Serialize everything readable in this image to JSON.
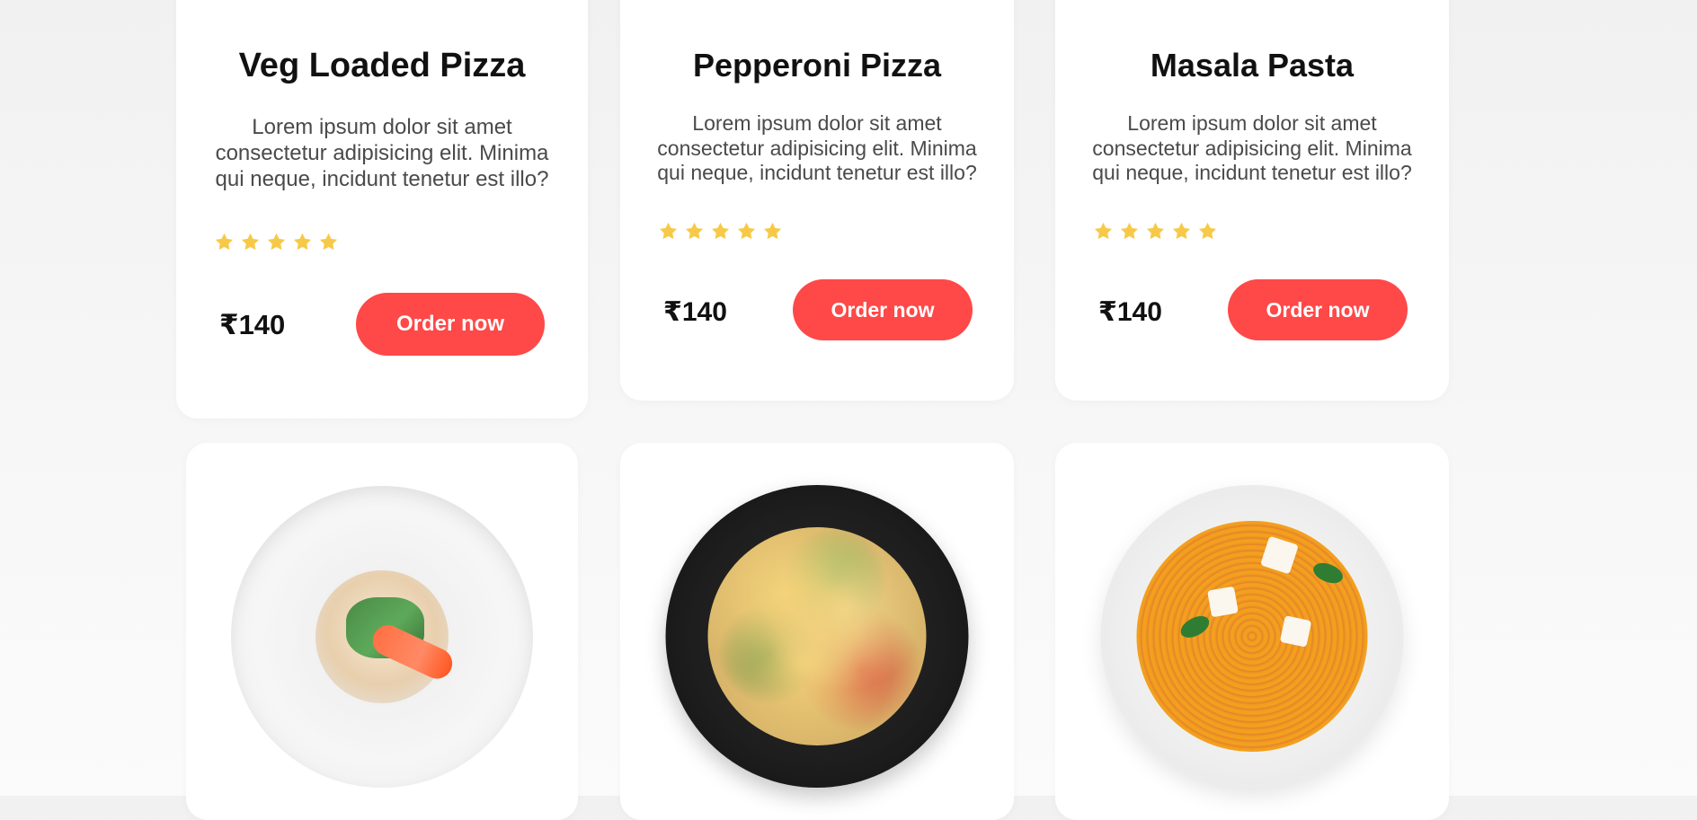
{
  "colors": {
    "accent": "#ff4848",
    "star": "#f7c948",
    "card_bg": "#ffffff"
  },
  "menu_items": [
    {
      "title": "Veg Loaded Pizza",
      "description": "Lorem ipsum dolor sit amet consectetur adipisicing elit. Minima qui neque, incidunt tenetur est illo?",
      "rating": 5,
      "price": "₹140",
      "button_label": "Order now",
      "image_icon": "pizza-image"
    },
    {
      "title": "Pepperoni Pizza",
      "description": "Lorem ipsum dolor sit amet consectetur adipisicing elit. Minima qui neque, incidunt tenetur est illo?",
      "rating": 5,
      "price": "₹140",
      "button_label": "Order now",
      "image_icon": "pizza-image"
    },
    {
      "title": "Masala Pasta",
      "description": "Lorem ipsum dolor sit amet consectetur adipisicing elit. Minima qui neque, incidunt tenetur est illo?",
      "rating": 5,
      "price": "₹140",
      "button_label": "Order now",
      "image_icon": "pasta-plate-image"
    }
  ],
  "lower_items": [
    {
      "image_icon": "risotto-plate-image"
    },
    {
      "image_icon": "penne-bowl-image"
    },
    {
      "image_icon": "spaghetti-plate-image"
    }
  ]
}
